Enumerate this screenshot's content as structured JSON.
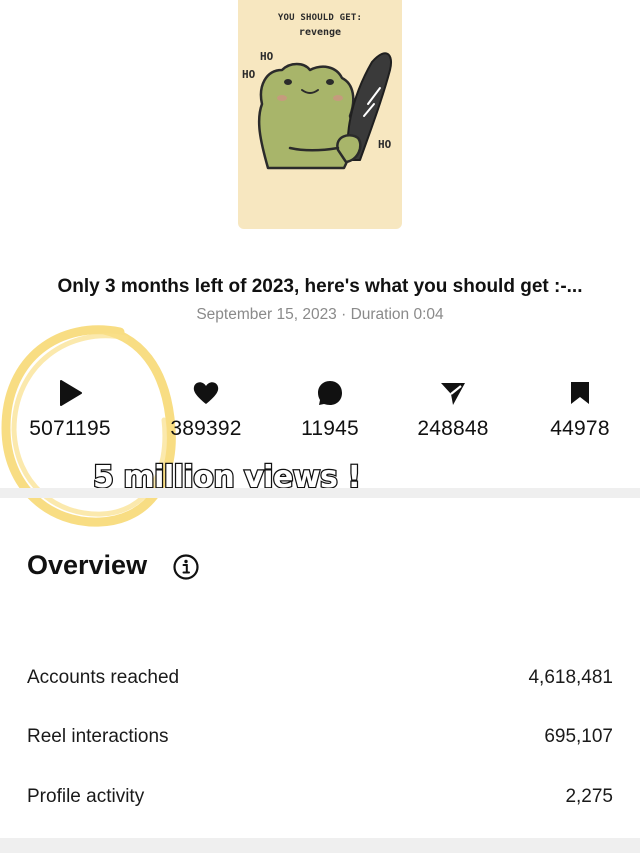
{
  "thumbnail": {
    "caption_line1": "YOU SHOULD GET:",
    "caption_line2": "revenge",
    "ho_left_top": "HO",
    "ho_left": "HO",
    "ho_right": "HO",
    "background_color": "#f7e7c0",
    "frog_color": "#a8b56a"
  },
  "reel": {
    "title": "Only 3 months left of 2023, here's what you should get :-...",
    "subtitle": "September 15, 2023 · Duration 0:04"
  },
  "stats": [
    {
      "icon": "play-icon",
      "value": "5071195"
    },
    {
      "icon": "heart-icon",
      "value": "389392"
    },
    {
      "icon": "comment-icon",
      "value": "11945"
    },
    {
      "icon": "share-icon",
      "value": "248848"
    },
    {
      "icon": "bookmark-icon",
      "value": "44978"
    }
  ],
  "annotation": {
    "text": "5 million views !",
    "circle_color": "#f6d25a"
  },
  "overview": {
    "title": "Overview",
    "info_icon": "info-icon",
    "rows": [
      {
        "label": "Accounts reached",
        "value": "4,618,481"
      },
      {
        "label": "Reel interactions",
        "value": "695,107"
      },
      {
        "label": "Profile activity",
        "value": "2,275"
      }
    ]
  }
}
